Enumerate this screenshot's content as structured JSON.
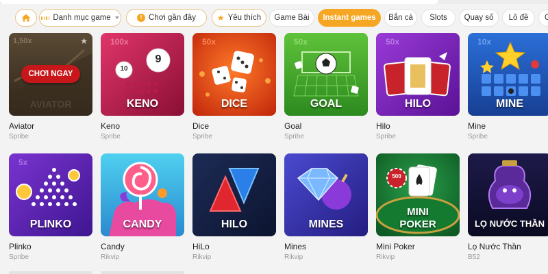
{
  "filters": [
    {
      "label": "",
      "icon": "home-icon"
    },
    {
      "label": "Danh mục game",
      "icon": "grid-icon",
      "dropdown": true
    },
    {
      "label": "Chơi gần đây",
      "icon": "clock-icon"
    },
    {
      "label": "Yêu thích",
      "icon": "star-icon"
    },
    {
      "label": "Game Bài"
    },
    {
      "label": "Instant games",
      "active": true
    },
    {
      "label": "Bắn cá"
    },
    {
      "label": "Slots"
    },
    {
      "label": "Quay số"
    },
    {
      "label": "Lô đề"
    },
    {
      "label": "G"
    }
  ],
  "colors": {
    "accent": "#f5a623",
    "play_button": "#c8171b"
  },
  "play_now": "CHƠI NGAY",
  "games": [
    {
      "title": "Aviator",
      "provider": "Spribe",
      "art_label": "AVIATOR",
      "art_badge": "1,50x",
      "selected": true
    },
    {
      "title": "Keno",
      "provider": "Spribe",
      "art_label": "KENO",
      "art_badge": "100x",
      "balls": [
        "10",
        "9"
      ]
    },
    {
      "title": "Dice",
      "provider": "Spribe",
      "art_label": "DICE",
      "art_badge": "50x"
    },
    {
      "title": "Goal",
      "provider": "Spribe",
      "art_label": "GOAL",
      "art_badge": "50x"
    },
    {
      "title": "Hilo",
      "provider": "Spribe",
      "art_label": "HILO",
      "art_badge": "50x"
    },
    {
      "title": "Mine",
      "provider": "Spribe",
      "art_label": "MINE",
      "art_badge": "10x"
    },
    {
      "title": "Plinko",
      "provider": "Spribe",
      "art_label": "PLINKO",
      "art_badge": "5x"
    },
    {
      "title": "Candy",
      "provider": "Rikvip",
      "art_label": "CANDY"
    },
    {
      "title": "HiLo",
      "provider": "Rikvip",
      "art_label": "HILO"
    },
    {
      "title": "Mines",
      "provider": "Rikvip",
      "art_label": "MINES"
    },
    {
      "title": "Mini Poker",
      "provider": "Rikvip",
      "art_label": "MINI POKER",
      "art_label_lines": [
        "MINI",
        "POKER"
      ],
      "art_badge": "500"
    },
    {
      "title": "Lọ Nước Thần",
      "provider": "B52",
      "art_label": "LỌ NƯỚC THẦN"
    }
  ]
}
